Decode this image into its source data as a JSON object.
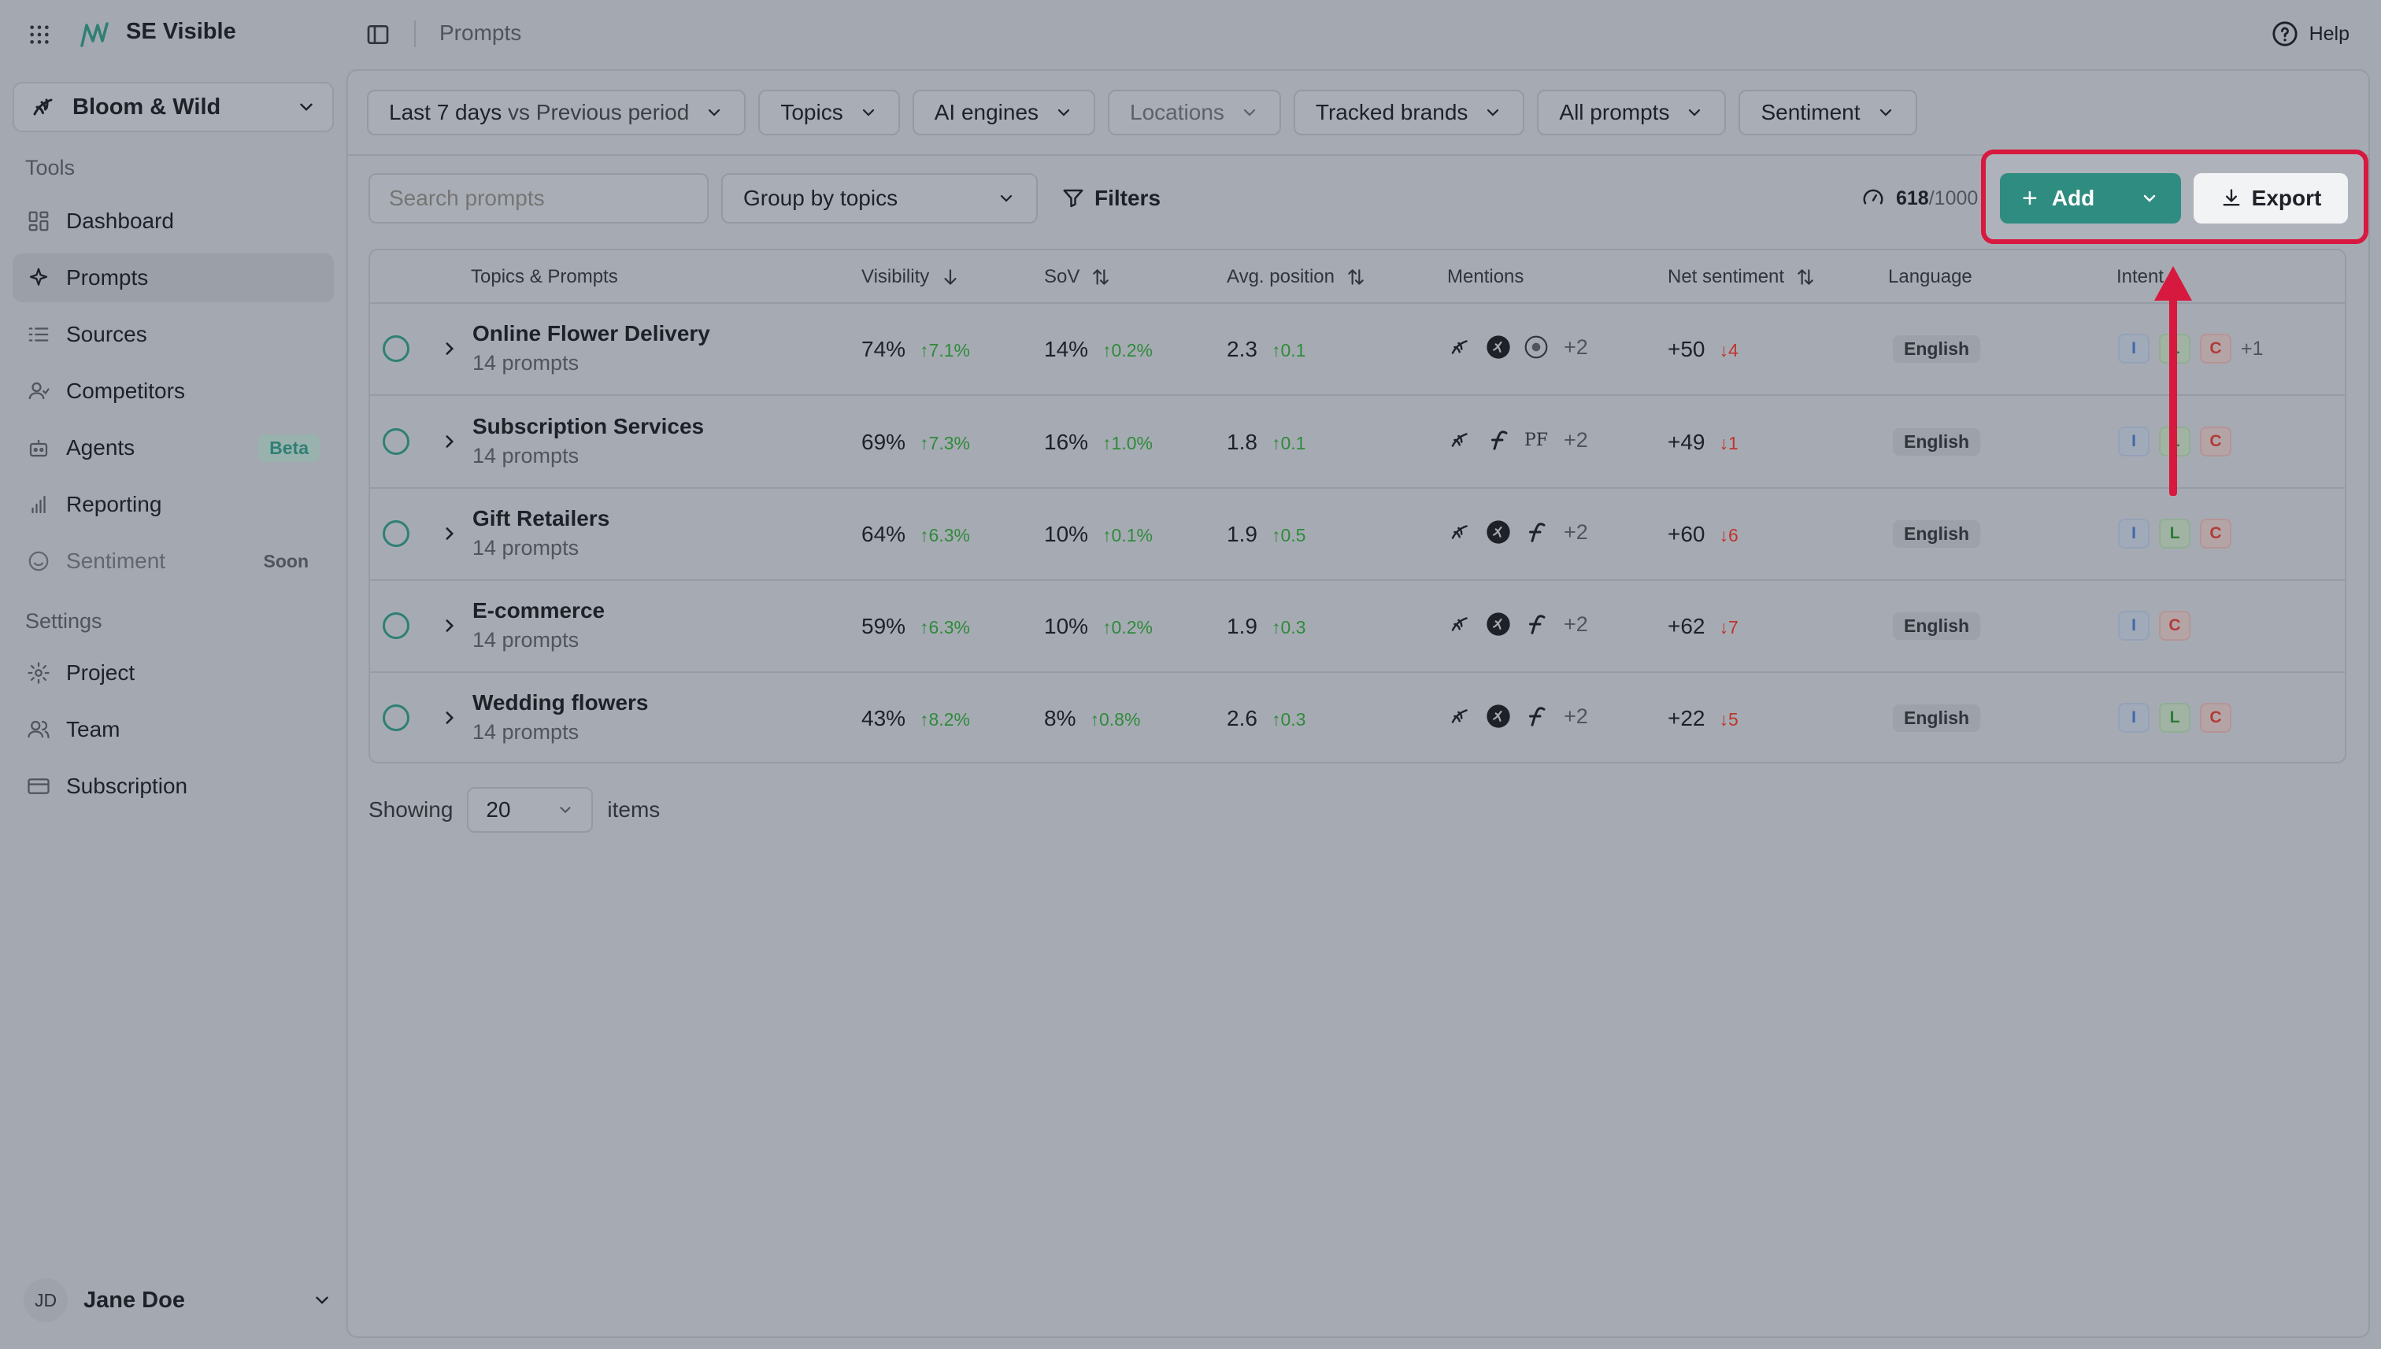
{
  "app": {
    "name": "SE Visible",
    "breadcrumb": "Prompts",
    "help_label": "Help"
  },
  "sidebar": {
    "brand": "Bloom & Wild",
    "tools_label": "Tools",
    "settings_label": "Settings",
    "tools": [
      {
        "label": "Dashboard",
        "icon": "dashboard-icon"
      },
      {
        "label": "Prompts",
        "icon": "sparkle-icon",
        "active": true
      },
      {
        "label": "Sources",
        "icon": "list-icon"
      },
      {
        "label": "Competitors",
        "icon": "users-icon"
      },
      {
        "label": "Agents",
        "icon": "bot-icon",
        "badge": "Beta"
      },
      {
        "label": "Reporting",
        "icon": "bar-chart-icon"
      },
      {
        "label": "Sentiment",
        "icon": "smile-icon",
        "badge": "Soon",
        "muted": true
      }
    ],
    "settings": [
      {
        "label": "Project",
        "icon": "gear-icon"
      },
      {
        "label": "Team",
        "icon": "team-icon"
      },
      {
        "label": "Subscription",
        "icon": "card-icon"
      }
    ],
    "user": {
      "initials": "JD",
      "name": "Jane Doe"
    }
  },
  "filters": {
    "period": "Last 7 days",
    "period_compare": "vs Previous period",
    "topics": "Topics",
    "engines": "AI engines",
    "locations": "Locations",
    "brands": "Tracked brands",
    "prompts": "All prompts",
    "sentiment": "Sentiment"
  },
  "toolbar": {
    "search_placeholder": "Search prompts",
    "group_by": "Group by topics",
    "filters_label": "Filters",
    "quota_used": "618",
    "quota_total": "/1000",
    "add_label": "Add",
    "export_label": "Export"
  },
  "table": {
    "headers": {
      "topics": "Topics & Prompts",
      "visibility": "Visibility",
      "sov": "SoV",
      "avg_position": "Avg. position",
      "mentions": "Mentions",
      "net_sentiment": "Net sentiment",
      "language": "Language",
      "intent": "Intent"
    },
    "rows": [
      {
        "name": "Online Flower Delivery",
        "sub": "14 prompts",
        "visibility": "74%",
        "visibility_delta": "↑7.1%",
        "sov": "14%",
        "sov_delta": "↑0.2%",
        "position": "2.3",
        "position_delta": "↑0.1",
        "mentions_more": "+2",
        "sentiment": "+50",
        "sentiment_delta": "↓4",
        "language": "English",
        "intent_more": "+1"
      },
      {
        "name": "Subscription Services",
        "sub": "14 prompts",
        "visibility": "69%",
        "visibility_delta": "↑7.3%",
        "sov": "16%",
        "sov_delta": "↑1.0%",
        "position": "1.8",
        "position_delta": "↑0.1",
        "mentions_more": "+2",
        "sentiment": "+49",
        "sentiment_delta": "↓1",
        "language": "English",
        "intent_more": ""
      },
      {
        "name": "Gift Retailers",
        "sub": "14 prompts",
        "visibility": "64%",
        "visibility_delta": "↑6.3%",
        "sov": "10%",
        "sov_delta": "↑0.1%",
        "position": "1.9",
        "position_delta": "↑0.5",
        "mentions_more": "+2",
        "sentiment": "+60",
        "sentiment_delta": "↓6",
        "language": "English",
        "intent_more": ""
      },
      {
        "name": "E-commerce",
        "sub": "14 prompts",
        "visibility": "59%",
        "visibility_delta": "↑6.3%",
        "sov": "10%",
        "sov_delta": "↑0.2%",
        "position": "1.9",
        "position_delta": "↑0.3",
        "mentions_more": "+2",
        "sentiment": "+62",
        "sentiment_delta": "↓7",
        "language": "English",
        "intent_more": ""
      },
      {
        "name": "Wedding flowers",
        "sub": "14 prompts",
        "visibility": "43%",
        "visibility_delta": "↑8.2%",
        "sov": "8%",
        "sov_delta": "↑0.8%",
        "position": "2.6",
        "position_delta": "↑0.3",
        "mentions_more": "+2",
        "sentiment": "+22",
        "sentiment_delta": "↓5",
        "language": "English",
        "intent_more": ""
      }
    ],
    "intent_letters": {
      "i": "I",
      "l": "L",
      "c": "C"
    },
    "mention_text_pf": "PF"
  },
  "pagination": {
    "showing_label": "Showing",
    "page_size": "20",
    "items_label": "items"
  },
  "colors": {
    "accent": "#2f8c80",
    "highlight": "#d7183f"
  }
}
